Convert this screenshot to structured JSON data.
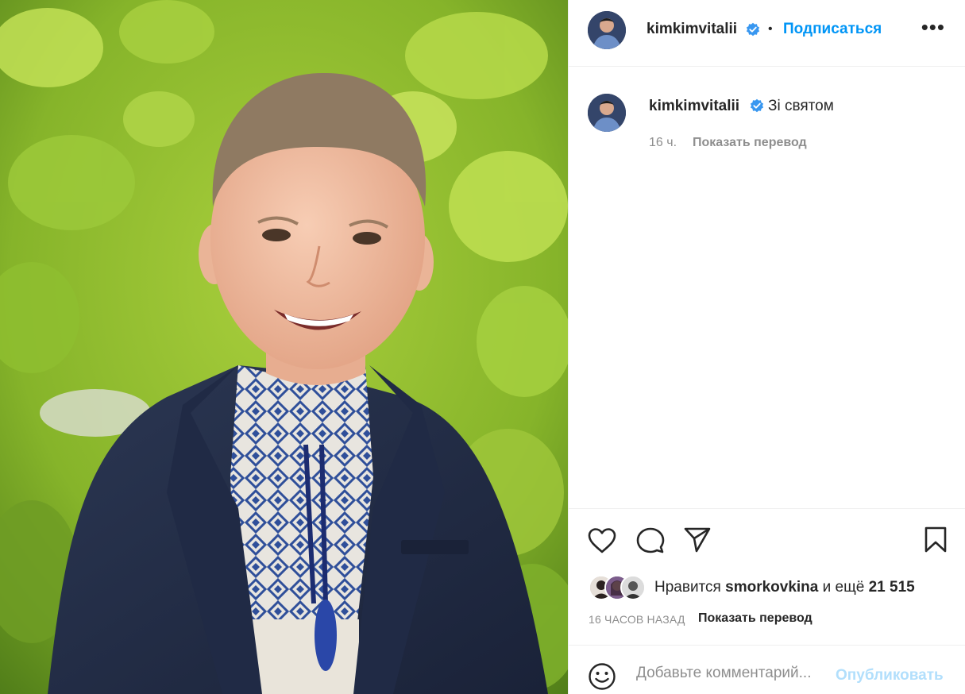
{
  "post": {
    "image_alt": "Smiling boy in a dark blazer and embroidered shirt in front of green leaves"
  },
  "header": {
    "username": "kimkimvitalii",
    "verified": true,
    "separator": "•",
    "follow_label": "Подписаться",
    "more_label": "•••"
  },
  "caption": {
    "username": "kimkimvitalii",
    "text": "Зі святом",
    "time": "16 ч.",
    "translate_label": "Показать перевод"
  },
  "actions": {
    "like_icon": "heart-icon",
    "comment_icon": "comment-icon",
    "share_icon": "send-icon",
    "save_icon": "bookmark-icon"
  },
  "likes": {
    "prefix": "Нравится",
    "user": "smorkovkina",
    "middle": "и ещё",
    "count": "21 515"
  },
  "post_time": "16 ЧАСОВ НАЗАД",
  "post_translate_label": "Показать перевод",
  "comment": {
    "emoji_icon": "smile-icon",
    "placeholder": "Добавьте комментарий...",
    "publish_label": "Опубликовать"
  },
  "colors": {
    "accent": "#0095f6",
    "accent_disabled": "#b2dffc",
    "verified": "#3897f0",
    "text": "#262626",
    "muted": "#8e8e8e"
  }
}
